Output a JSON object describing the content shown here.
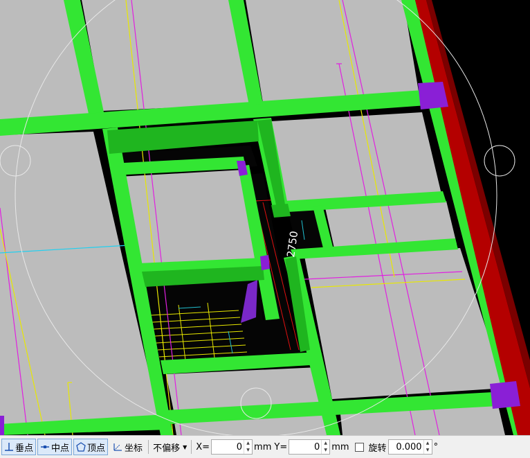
{
  "viewport": {
    "dimension_text": "2750"
  },
  "statusbar": {
    "snap_perpendicular": "垂点",
    "snap_midpoint": "中点",
    "snap_vertex": "顶点",
    "snap_coordinate": "坐标",
    "offset_mode": "不偏移",
    "x_label": "X=",
    "x_value": "0",
    "x_unit": "mm",
    "y_label": "Y=",
    "y_value": "0",
    "y_unit": "mm",
    "rotate_label": "旋转",
    "rotate_value": "0.000",
    "rotate_unit": "°"
  },
  "colors": {
    "slab": "#bcbcbc",
    "beam": "#33e633",
    "beam_dark": "#1fb51f",
    "column": "#8a1fd6",
    "wall": "#b40000",
    "line_magenta": "#e020e0",
    "line_yellow": "#f0f000",
    "line_cyan": "#20d0f0"
  }
}
